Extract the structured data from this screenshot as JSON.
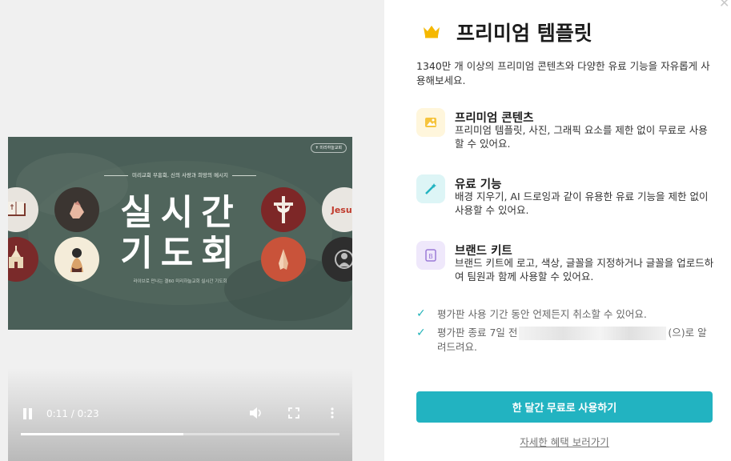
{
  "video": {
    "slide": {
      "badge": "✝ 미리하늘교회",
      "subtitle": "미리교회 부흥회, 신의 사랑과 희망의 메시지",
      "title_line1": "실시간",
      "title_line2": "기도회",
      "description": "라이브로 만나는 결60 미리하늘교회 실시간 기도회",
      "circle_text": "Jesus"
    },
    "current_time": "0:11",
    "time_separator": "/",
    "duration": "0:23",
    "progress": 0.51
  },
  "dialog": {
    "close_icon": "close-icon",
    "title": "프리미엄 템플릿",
    "intro": "1340만 개 이상의 프리미엄 콘텐츠와 다양한 유료 기능을 자유롭게 사용해보세요.",
    "features": [
      {
        "icon": "image-icon",
        "title": "프리미엄 콘텐츠",
        "description": "프리미엄 템플릿, 사진, 그래픽 요소를 제한 없이 무료로 사용할 수 있어요."
      },
      {
        "icon": "magic-wand-icon",
        "title": "유료 기능",
        "description": "배경 지우기, AI 드로잉과 같이 유용한 유료 기능을 제한 없이 사용할 수 있어요."
      },
      {
        "icon": "brand-kit-icon",
        "title": "브랜드 키트",
        "description": "브랜드 키트에 로고, 색상, 글꼴을 지정하거나 글꼴을 업로드하여 팀원과 함께 사용할 수 있어요."
      }
    ],
    "checks": [
      {
        "text": "평가판 사용 기간 동안 언제든지 취소할 수 있어요."
      },
      {
        "text_before": "평가판 종료 7일 전",
        "text_after": "(으)로 알려드려요."
      }
    ],
    "cta_label": "한 달간 무료로 사용하기",
    "more_link": "자세한 혜택 보러가기",
    "colors": {
      "accent": "#22b3c1",
      "crown": "#f5b800",
      "check": "#22b3b8"
    }
  }
}
